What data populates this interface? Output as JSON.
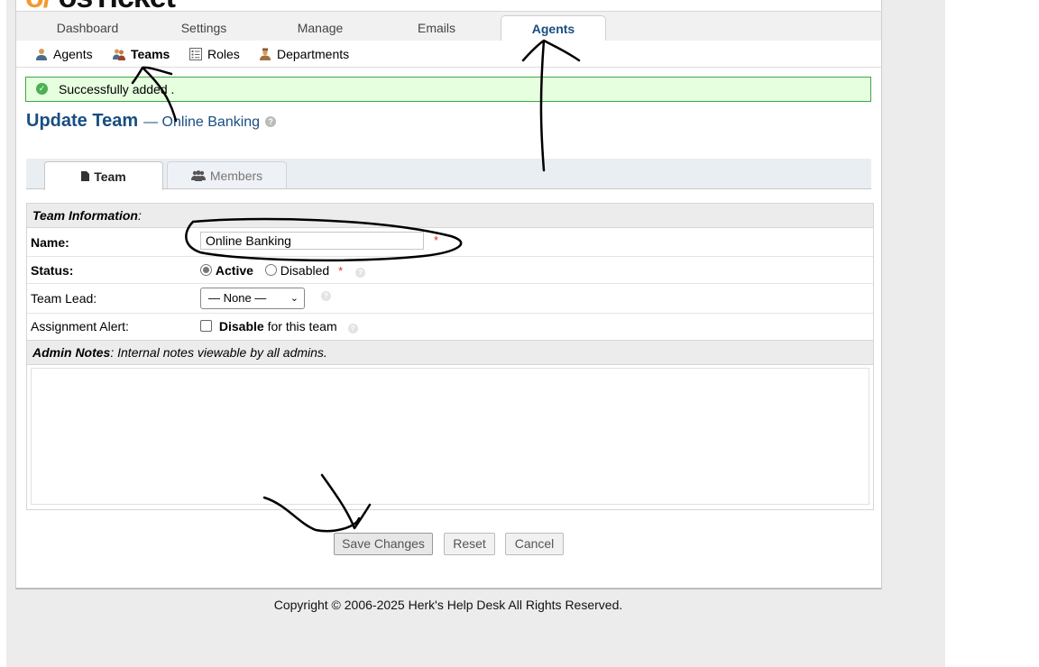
{
  "main_nav": {
    "tabs": [
      {
        "label": "Dashboard",
        "active": false
      },
      {
        "label": "Settings",
        "active": false
      },
      {
        "label": "Manage",
        "active": false
      },
      {
        "label": "Emails",
        "active": false
      },
      {
        "label": "Agents",
        "active": true
      }
    ]
  },
  "sub_nav": {
    "items": [
      {
        "label": "Agents",
        "icon": "agent-icon",
        "active": false
      },
      {
        "label": "Teams",
        "icon": "teams-icon",
        "active": true
      },
      {
        "label": "Roles",
        "icon": "roles-icon",
        "active": false
      },
      {
        "label": "Departments",
        "icon": "departments-icon",
        "active": false
      }
    ]
  },
  "alert": {
    "text": "Successfully added .",
    "type": "success"
  },
  "title": {
    "main": "Update Team",
    "subtitle": "— Online Banking"
  },
  "form_tabs": [
    {
      "label": "Team",
      "icon": "file-icon",
      "active": true
    },
    {
      "label": "Members",
      "icon": "users-icon",
      "active": false
    }
  ],
  "form": {
    "section_team": "Team Information",
    "name_label": "Name:",
    "name_value": "Online Banking",
    "status_label": "Status:",
    "status_active": "Active",
    "status_disabled": "Disabled",
    "status_selected": "Active",
    "lead_label": "Team Lead:",
    "lead_value": "— None —",
    "alert_label": "Assignment Alert:",
    "alert_disable": "Disable",
    "alert_suffix": "for this team",
    "alert_checked": false,
    "section_notes": "Admin Notes",
    "section_notes_desc": ": Internal notes viewable by all admins.",
    "notes_value": ""
  },
  "buttons": {
    "save": "Save Changes",
    "reset": "Reset",
    "cancel": "Cancel"
  },
  "footer": "Copyright © 2006-2025 Herk's Help Desk All Rights Reserved.",
  "colors": {
    "accent": "#184e81",
    "success_bg": "#e6ffdf",
    "success_border": "#3fa64a",
    "required": "#e03030"
  }
}
